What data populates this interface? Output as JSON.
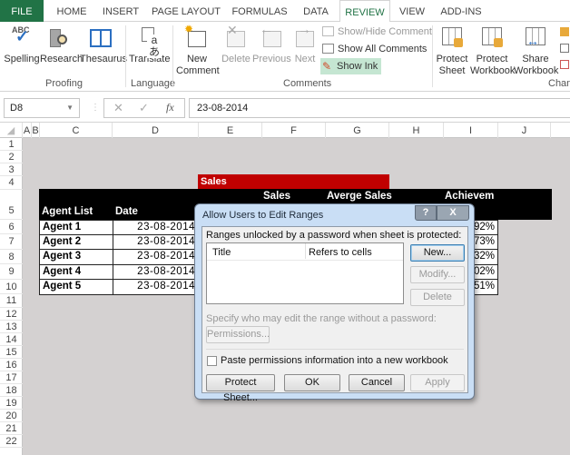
{
  "tabs": [
    {
      "label": "FILE",
      "active": false
    },
    {
      "label": "HOME",
      "active": false
    },
    {
      "label": "INSERT",
      "active": false
    },
    {
      "label": "PAGE LAYOUT",
      "active": false
    },
    {
      "label": "FORMULAS",
      "active": false
    },
    {
      "label": "DATA",
      "active": false
    },
    {
      "label": "REVIEW",
      "active": true
    },
    {
      "label": "VIEW",
      "active": false
    },
    {
      "label": "ADD-INS",
      "active": false
    }
  ],
  "ribbon": {
    "proofing": {
      "group": "Proofing",
      "spelling": "Spelling",
      "research": "Research",
      "thesaurus": "Thesaurus"
    },
    "language": {
      "group": "Language",
      "translate": "Translate"
    },
    "comments": {
      "group": "Comments",
      "new_line1": "New",
      "new_line2": "Comment",
      "delete": "Delete",
      "previous": "Previous",
      "next": "Next",
      "show_hide": "Show/Hide Comment",
      "show_all": "Show All Comments",
      "show_ink": "Show Ink"
    },
    "changes": {
      "group": "Chan",
      "protect_sheet_1": "Protect",
      "protect_sheet_2": "Sheet",
      "protect_wb_1": "Protect",
      "protect_wb_2": "Workbook",
      "share_wb_1": "Share",
      "share_wb_2": "Workbook"
    },
    "accent": "#217346",
    "show_ink_bg": "#c5e6d2"
  },
  "formula_bar": {
    "name_box": "D8",
    "cancel": "✕",
    "enter": "✓",
    "fx": "fx",
    "value": "23-08-2014"
  },
  "columns": [
    "A",
    "B",
    "C",
    "D",
    "E",
    "F",
    "G",
    "H",
    "I",
    "J"
  ],
  "rows": [
    "1",
    "2",
    "3",
    "4",
    "5",
    "6",
    "7",
    "8",
    "9",
    "10",
    "11",
    "12",
    "13",
    "14",
    "15",
    "16",
    "17",
    "18",
    "19",
    "20",
    "21",
    "22"
  ],
  "sheet": {
    "sales_banner": "Sales",
    "header": {
      "agent_list": "Agent List",
      "date": "Date",
      "sales": "Sales",
      "avg_sales": "Averge Sales",
      "achievement": "Achievem"
    },
    "rows": [
      {
        "agent": "Agent 1",
        "date": "23-08-2014",
        "achievement": "92%"
      },
      {
        "agent": "Agent 2",
        "date": "23-08-2014",
        "achievement": "73%"
      },
      {
        "agent": "Agent 3",
        "date": "23-08-2014",
        "achievement": "32%"
      },
      {
        "agent": "Agent 4",
        "date": "23-08-2014",
        "achievement": "02%"
      },
      {
        "agent": "Agent 5",
        "date": "23-08-2014",
        "achievement": "51%"
      }
    ],
    "banner_color": "#c00000"
  },
  "dialog": {
    "title": "Allow Users to Edit Ranges",
    "help": "?",
    "close": "X",
    "ranges_label": "Ranges unlocked by a password when sheet is protected:",
    "col_title": "Title",
    "col_refers": "Refers to cells",
    "new": "New...",
    "modify": "Modify...",
    "delete": "Delete",
    "specify_label": "Specify who may edit the range without a password:",
    "permissions": "Permissions...",
    "paste_checkbox": "Paste permissions information into a new workbook",
    "paste_checked": false,
    "protect_sheet": "Protect Sheet...",
    "ok": "OK",
    "cancel": "Cancel",
    "apply": "Apply"
  }
}
